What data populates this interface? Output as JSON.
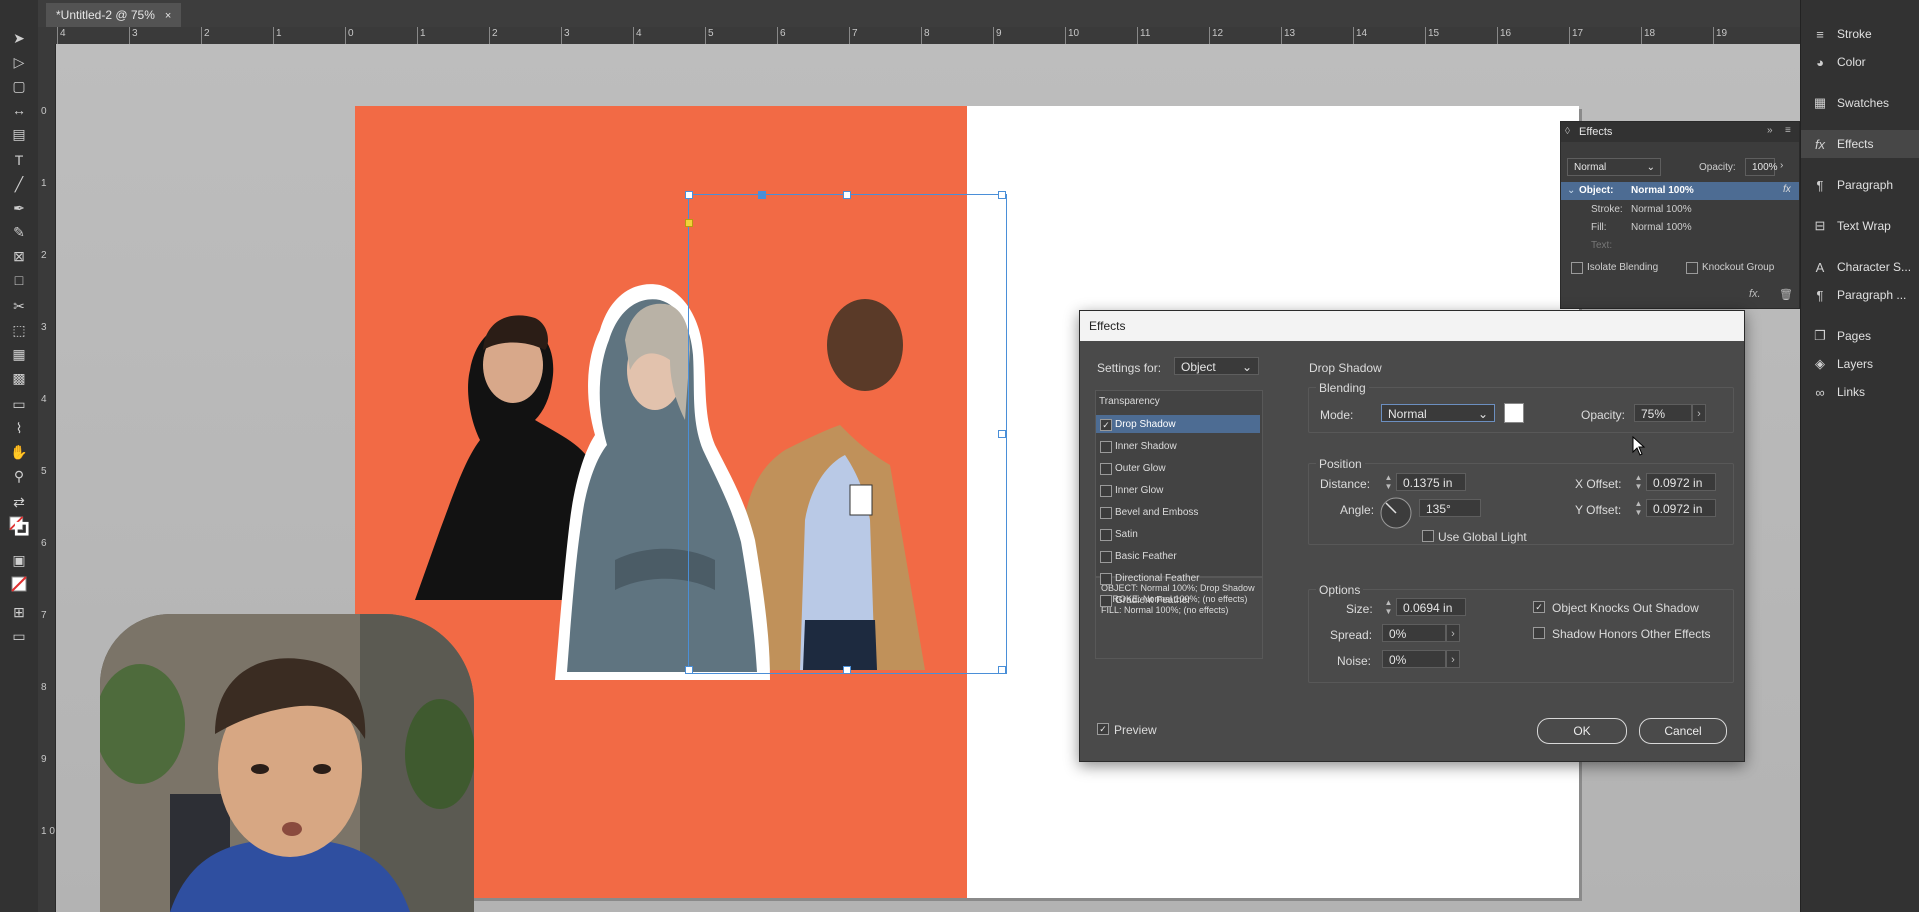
{
  "document_tab": {
    "title": "*Untitled-2 @ 75%",
    "close": "×"
  },
  "ruler": {
    "horizontal": [
      "4",
      "3",
      "2",
      "1",
      "0",
      "1",
      "2",
      "3",
      "4",
      "5",
      "6",
      "7",
      "8",
      "9",
      "10",
      "11",
      "12",
      "13",
      "14",
      "15",
      "16",
      "17",
      "18",
      "19"
    ],
    "vertical": [
      "0",
      "1",
      "2",
      "3",
      "4",
      "5",
      "6",
      "7",
      "8",
      "9",
      "1 0"
    ]
  },
  "right_panels": [
    {
      "label": "Stroke",
      "icon": "stroke-icon"
    },
    {
      "label": "Color",
      "icon": "color-icon"
    },
    {
      "label": "Swatches",
      "icon": "swatches-icon"
    },
    {
      "label": "Effects",
      "icon": "fx-icon",
      "active": true
    },
    {
      "label": "Paragraph",
      "icon": "paragraph-icon"
    },
    {
      "label": "Text Wrap",
      "icon": "text-wrap-icon"
    },
    {
      "label": "Character S...",
      "icon": "character-styles-icon"
    },
    {
      "label": "Paragraph ...",
      "icon": "paragraph-styles-icon"
    },
    {
      "label": "Pages",
      "icon": "pages-icon"
    },
    {
      "label": "Layers",
      "icon": "layers-icon"
    },
    {
      "label": "Links",
      "icon": "links-icon"
    }
  ],
  "effects_panel": {
    "title": "Effects",
    "blend_mode": "Normal",
    "opacity_label": "Opacity:",
    "opacity": "100%",
    "rows": [
      {
        "label": "Object:",
        "value": "Normal 100%"
      },
      {
        "label": "Stroke:",
        "value": "Normal 100%"
      },
      {
        "label": "Fill:",
        "value": "Normal 100%"
      },
      {
        "label": "Text:",
        "value": ""
      }
    ],
    "isolate_blending": "Isolate Blending",
    "knockout_group": "Knockout Group"
  },
  "dialog": {
    "title": "Effects",
    "settings_for_label": "Settings for:",
    "settings_for_value": "Object",
    "section_heading": "Drop Shadow",
    "transparency_heading": "Transparency",
    "effects_list": [
      {
        "label": "Drop Shadow",
        "checked": true
      },
      {
        "label": "Inner Shadow",
        "checked": false
      },
      {
        "label": "Outer Glow",
        "checked": false
      },
      {
        "label": "Inner Glow",
        "checked": false
      },
      {
        "label": "Bevel and Emboss",
        "checked": false
      },
      {
        "label": "Satin",
        "checked": false
      },
      {
        "label": "Basic Feather",
        "checked": false
      },
      {
        "label": "Directional Feather",
        "checked": false
      },
      {
        "label": "Gradient Feather",
        "checked": false
      }
    ],
    "summary": [
      "OBJECT: Normal 100%; Drop Shadow",
      "STROKE: Normal 100%; (no effects)",
      "FILL: Normal 100%; (no effects)"
    ],
    "blending": {
      "heading": "Blending",
      "mode_label": "Mode:",
      "mode": "Normal",
      "opacity_label": "Opacity:",
      "opacity": "75%",
      "shadow_color": "#ffffff"
    },
    "position": {
      "heading": "Position",
      "distance_label": "Distance:",
      "distance": "0.1375 in",
      "angle_label": "Angle:",
      "angle": "135°",
      "x_offset_label": "X Offset:",
      "x_offset": "0.0972 in",
      "y_offset_label": "Y Offset:",
      "y_offset": "0.0972 in",
      "use_global_light": "Use Global Light"
    },
    "options": {
      "heading": "Options",
      "size_label": "Size:",
      "size": "0.0694 in",
      "spread_label": "Spread:",
      "spread": "0%",
      "noise_label": "Noise:",
      "noise": "0%",
      "knocks_out": "Object Knocks Out Shadow",
      "honors_effects": "Shadow Honors Other Effects"
    },
    "preview": "Preview",
    "ok": "OK",
    "cancel": "Cancel"
  },
  "colors": {
    "page_accent": "#f26a45",
    "selection": "#4a8fd8"
  }
}
